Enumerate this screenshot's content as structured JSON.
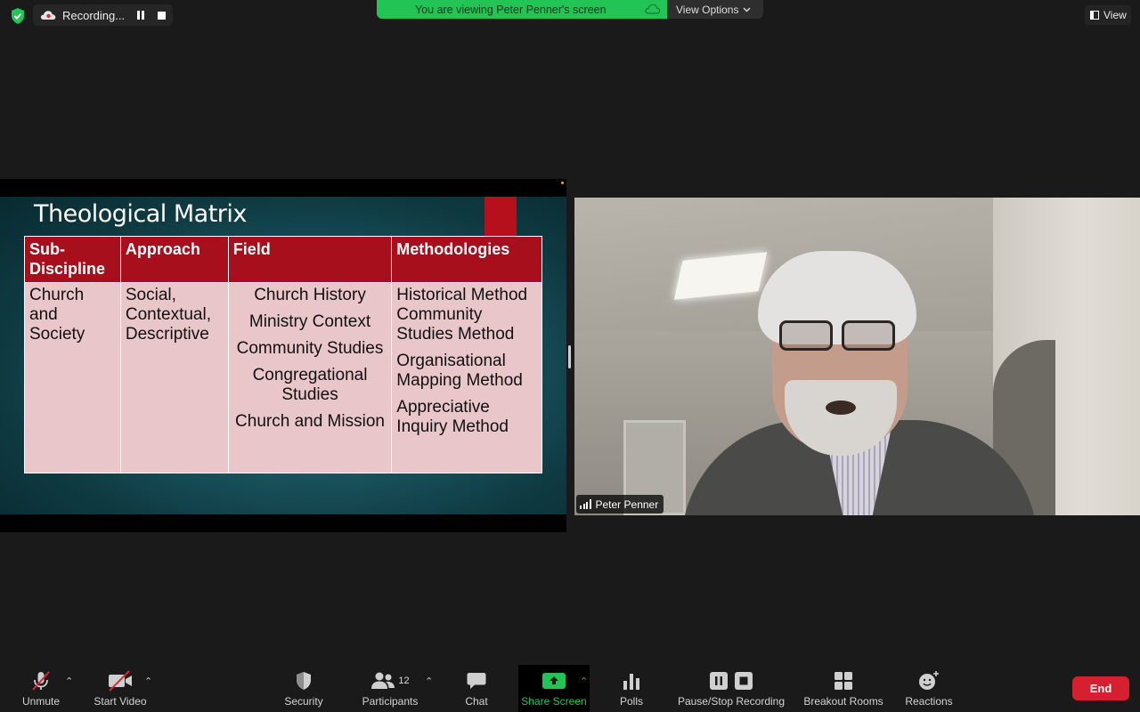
{
  "top": {
    "recording_label": "Recording...",
    "viewing_banner": "You are viewing Peter Penner's screen",
    "view_options": "View Options",
    "view": "View"
  },
  "slide": {
    "title": "Theological Matrix",
    "headers": [
      "Sub-Discipline",
      "Approach",
      "Field",
      "Methodologies"
    ],
    "subdiscipline": [
      "Church and Society"
    ],
    "approach": [
      "Social, Contextual, Descriptive"
    ],
    "fields": [
      "Church History",
      "Ministry Context",
      "Community Studies",
      "Congregational Studies",
      "Church and Mission"
    ],
    "methodologies": [
      "Historical Method",
      "Community Studies Method",
      "Organisational Mapping Method",
      "Appreciative Inquiry Method"
    ]
  },
  "video": {
    "participant_name": "Peter Penner"
  },
  "toolbar": {
    "unmute": "Unmute",
    "start_video": "Start Video",
    "security": "Security",
    "participants": "Participants",
    "participants_count": "12",
    "chat": "Chat",
    "share_screen": "Share Screen",
    "polls": "Polls",
    "pause_stop_recording": "Pause/Stop Recording",
    "breakout_rooms": "Breakout Rooms",
    "reactions": "Reactions",
    "end": "End"
  },
  "colors": {
    "share_green": "#22c456",
    "end_red": "#d7202f",
    "slide_header_red": "#a70f1d",
    "slide_cell_pink": "#e8c6ca"
  },
  "icons": [
    "shield-icon",
    "cloud-icon",
    "pause-icon",
    "stop-icon",
    "chevron-down-icon",
    "mic-muted-icon",
    "video-off-icon",
    "security-shield-icon",
    "participants-icon",
    "chat-icon",
    "share-screen-icon",
    "polls-icon",
    "breakout-rooms-icon",
    "reactions-icon",
    "signal-bars-icon"
  ]
}
